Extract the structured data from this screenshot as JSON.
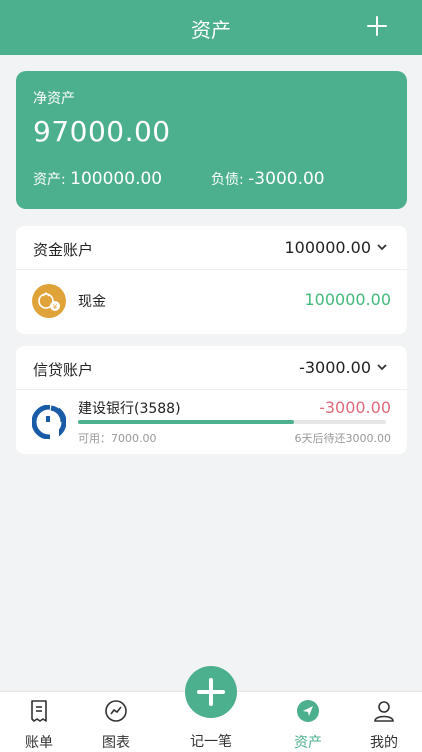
{
  "header": {
    "title": "资产",
    "add_icon": "plus-icon"
  },
  "summary": {
    "net_label": "净资产",
    "net_value": "97000.00",
    "assets_label": "资产: ",
    "assets_value": "100000.00",
    "liabilities_label": "负债: ",
    "liabilities_value": "-3000.00"
  },
  "fund_account": {
    "title": "资金账户",
    "total": "100000.00",
    "items": [
      {
        "name": "现金",
        "amount": "100000.00",
        "icon": "cash-coin-icon"
      }
    ]
  },
  "credit_account": {
    "title": "信贷账户",
    "total": "-3000.00",
    "items": [
      {
        "name": "建设银行(3588)",
        "amount": "-3000.00",
        "available": "可用：7000.00",
        "due": "6天后待还3000.00",
        "available_fraction": 0.7,
        "icon": "ccb-bank-icon"
      }
    ]
  },
  "tabbar": {
    "tabs": [
      {
        "label": "账单",
        "icon": "bill-icon"
      },
      {
        "label": "图表",
        "icon": "chart-icon"
      },
      {
        "label": "记一笔",
        "icon": "plus-icon"
      },
      {
        "label": "资产",
        "icon": "asset-navigation-icon",
        "active": true
      },
      {
        "label": "我的",
        "icon": "user-icon"
      }
    ]
  },
  "colors": {
    "accent": "#4caf8e",
    "positive": "#43b97a",
    "negative": "#e06a7c",
    "coin": "#e0a33a",
    "bank": "#1a5ba8"
  }
}
